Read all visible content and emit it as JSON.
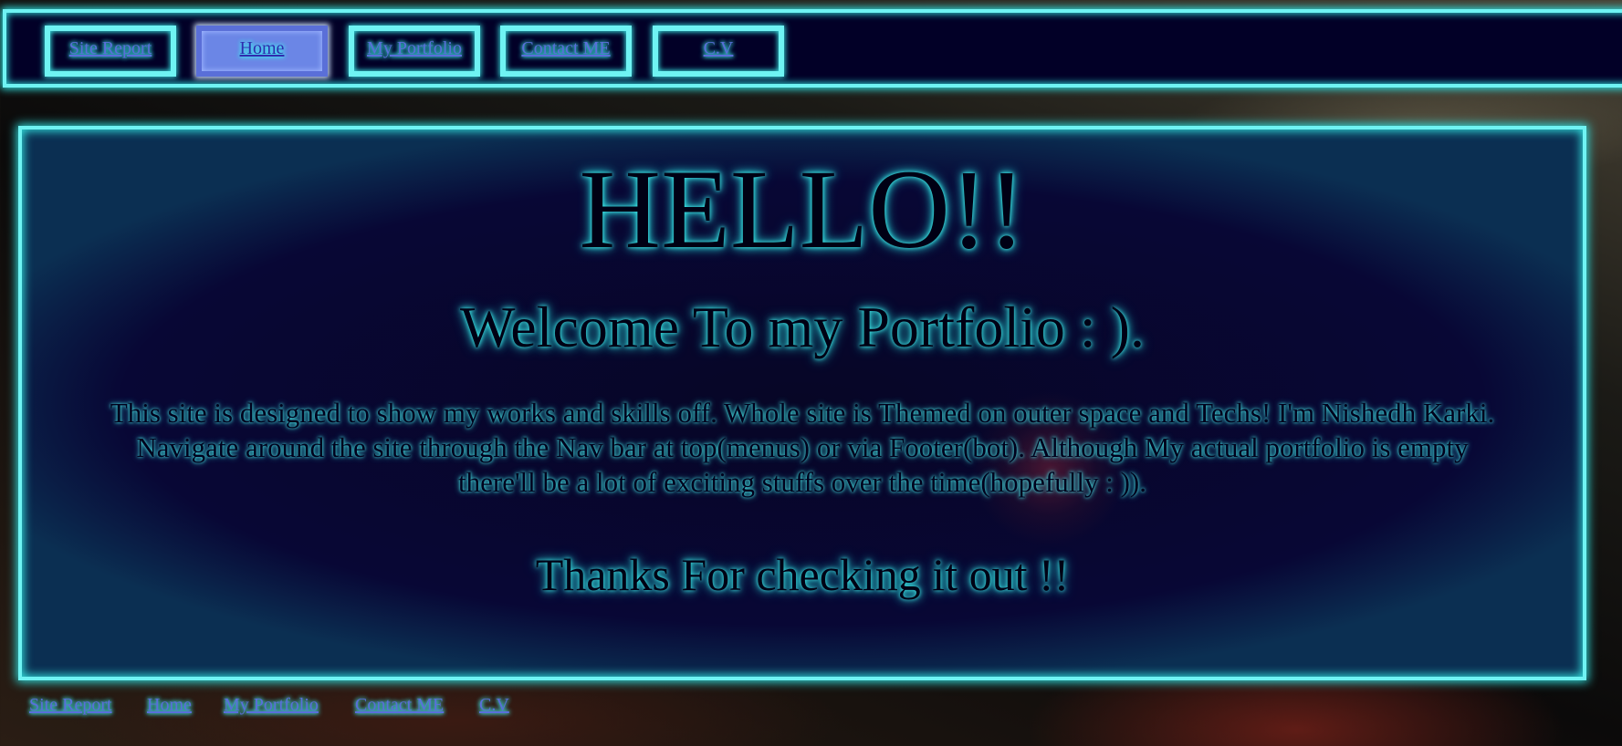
{
  "topnav": {
    "items": [
      {
        "label": "Site Report",
        "active": false
      },
      {
        "label": "Home",
        "active": true
      },
      {
        "label": "My Portfolio",
        "active": false
      },
      {
        "label": "Contact ME",
        "active": false
      },
      {
        "label": "C.V",
        "active": false
      }
    ]
  },
  "main": {
    "heading": "HELLO!!",
    "subheading": "Welcome To my Portfolio : ).",
    "intro_lines": [
      "This site is designed to show my works and skills off. Whole site is Themed on outer space and Techs! I'm Nishedh Karki.",
      "Navigate around the site through the Nav bar at top(menus) or via Footer(bot). Although My actual portfolio is empty",
      "there'll be a lot of exciting stuffs over the time(hopefully : ))."
    ],
    "thanks": "Thanks For checking it out !!"
  },
  "footer": {
    "links": [
      "Site Report",
      "Home",
      "My Portfolio",
      "Contact ME ",
      "C.V"
    ]
  },
  "colors": {
    "accent_cyan": "#6ff3f3",
    "nav_background": "#020027",
    "active_button": "#6b86e6",
    "link_text": "#5a6eda"
  }
}
